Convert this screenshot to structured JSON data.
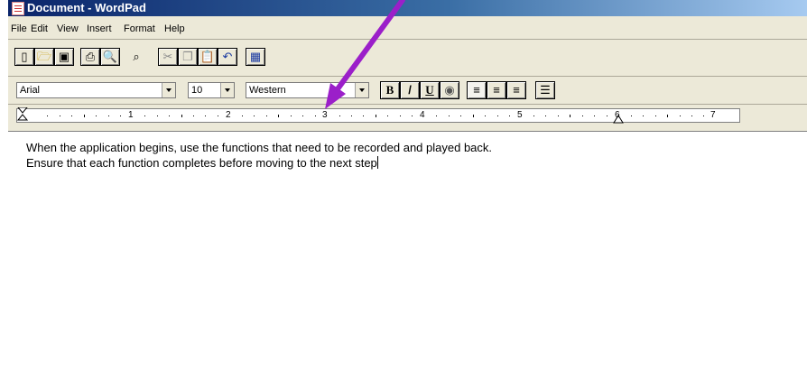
{
  "window": {
    "title": "Document - WordPad"
  },
  "menu": [
    "File",
    "Edit",
    "View",
    "Insert",
    "Format",
    "Help"
  ],
  "toolbar": {
    "buttons": [
      "new-icon",
      "open-icon",
      "save-icon",
      "print-icon",
      "print-preview-icon",
      "find-icon",
      "cut-icon",
      "copy-icon",
      "paste-icon",
      "undo-icon",
      "insert-date-time-icon"
    ]
  },
  "format_bar": {
    "font": "Arial",
    "size": "10",
    "script": "Western",
    "bold_label": "B",
    "italic_label": "/",
    "underline_label": "U"
  },
  "ruler": {
    "numbers": [
      "1",
      "2",
      "3",
      "4",
      "5",
      "6",
      "7"
    ]
  },
  "document": {
    "lines": [
      "When the application begins, use the functions that need to be recorded and played back.",
      "Ensure that each function completes before moving to the next step"
    ]
  },
  "annotation": {
    "arrow_color": "#9b1fc9"
  }
}
